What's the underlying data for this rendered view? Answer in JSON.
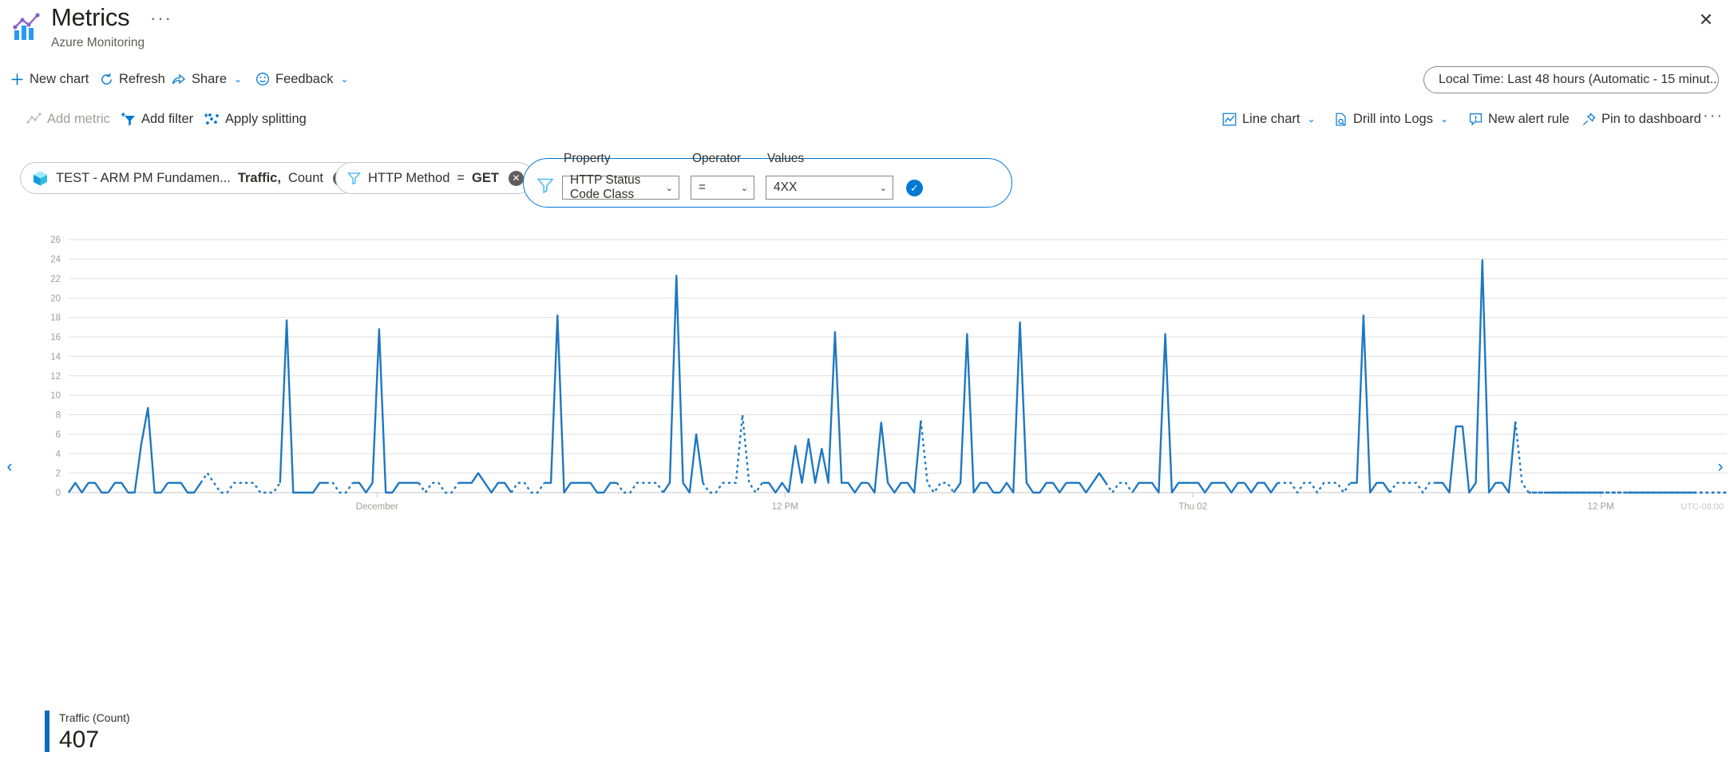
{
  "header": {
    "title": "Metrics",
    "subtitle": "Azure Monitoring",
    "more_label": "···",
    "close_label": "✕",
    "icon": "metrics-chart-icon"
  },
  "toolbar_primary": {
    "new_chart": "New chart",
    "refresh": "Refresh",
    "share": "Share",
    "feedback": "Feedback",
    "chevron": "⌄",
    "time_range": "Local Time: Last 48 hours (Automatic - 15 minut..."
  },
  "toolbar_secondary": {
    "add_metric": "Add metric",
    "add_metric_disabled": true,
    "add_filter": "Add filter",
    "apply_splitting": "Apply splitting",
    "line_chart": "Line chart",
    "drill_into_logs": "Drill into Logs",
    "new_alert_rule": "New alert rule",
    "pin_to_dashboard": "Pin to dashboard",
    "overflow": "···"
  },
  "chips": [
    {
      "icon": "resource-cube-icon",
      "resource": "TEST - ARM PM Fundamen...",
      "metric": "Traffic,",
      "aggregation": "Count",
      "remove": "✕"
    },
    {
      "icon": "filter-funnel-icon",
      "property": "HTTP Method",
      "operator": "=",
      "value": "GET",
      "remove": "✕"
    }
  ],
  "filter_editor": {
    "icon": "filter-funnel-icon",
    "property_label": "Property",
    "property_value": "HTTP Status Code Class",
    "operator_label": "Operator",
    "operator_value": "=",
    "values_label": "Values",
    "values_value": "4XX",
    "confirm": "✓",
    "caret": "⌄"
  },
  "navigation": {
    "prev": "‹",
    "next": "›"
  },
  "legend": {
    "series_name": "Traffic (Count)",
    "series_value": "407",
    "color": "#0f6cbd"
  },
  "colors": {
    "accent": "#0078d4",
    "line": "#1f78c1",
    "grid": "#e1dfdd",
    "axis_text": "#a19f9d"
  },
  "chart_data": {
    "type": "line",
    "title": "",
    "xlabel": "",
    "ylabel": "",
    "ylim": [
      0,
      27
    ],
    "yticks": [
      0,
      2,
      4,
      6,
      8,
      10,
      12,
      14,
      16,
      18,
      20,
      22,
      24,
      26
    ],
    "grid": true,
    "legend_position": "bottom-left",
    "timezone_note": "UTC-08:00",
    "xtick_labels": [
      "December",
      "12 PM",
      "Thu 02",
      "12 PM"
    ],
    "xtick_positions": [
      0.186,
      0.432,
      0.678,
      0.924
    ],
    "series": [
      {
        "name": "Traffic (Count)",
        "color": "#1f78c1",
        "total": 407,
        "values": [
          0,
          1,
          0,
          1,
          1,
          0,
          0,
          1,
          1,
          0,
          0,
          5,
          8.7,
          0,
          0,
          1,
          1,
          1,
          0,
          0,
          1,
          2,
          1,
          0,
          0,
          1,
          1,
          1,
          1,
          0,
          0,
          0,
          1,
          17.7,
          0,
          0,
          0,
          0,
          1,
          1,
          1,
          0,
          0,
          1,
          1,
          0,
          1,
          16.8,
          0,
          0,
          1,
          1,
          1,
          1,
          0,
          1,
          1,
          0,
          0,
          1,
          1,
          1,
          2,
          1,
          0,
          1,
          1,
          0,
          1,
          1,
          0,
          0,
          1,
          1,
          18.2,
          0,
          1,
          1,
          1,
          1,
          0,
          0,
          1,
          1,
          0,
          0,
          1,
          1,
          1,
          1,
          0,
          1,
          22.3,
          1,
          0,
          6,
          1,
          0,
          0,
          1,
          1,
          1,
          8,
          1,
          0,
          1,
          1,
          0,
          1,
          0,
          4.8,
          1,
          5.5,
          1,
          4.5,
          1,
          16.5,
          1,
          1,
          0,
          1,
          1,
          0,
          7.2,
          1,
          0,
          1,
          1,
          0,
          7.4,
          1,
          0,
          1,
          1,
          0,
          1,
          16.3,
          0,
          1,
          1,
          0,
          0,
          1,
          0,
          17.5,
          1,
          0,
          0,
          1,
          1,
          0,
          1,
          1,
          1,
          0,
          1,
          2,
          1,
          0,
          1,
          1,
          0,
          1,
          1,
          1,
          0,
          16.3,
          0,
          1,
          1,
          1,
          1,
          0,
          1,
          1,
          1,
          0,
          1,
          1,
          0,
          1,
          1,
          0,
          1,
          1,
          1,
          0,
          1,
          1,
          0,
          1,
          1,
          1,
          0,
          1,
          1,
          18.2,
          0,
          1,
          1,
          0,
          1,
          1,
          1,
          1,
          0,
          1,
          1,
          1,
          0,
          6.8,
          6.8,
          0,
          1,
          23.9,
          0,
          1,
          1,
          0,
          7.3,
          1,
          0,
          0,
          0,
          0,
          0,
          0,
          0,
          0,
          0,
          0,
          0,
          0,
          0,
          0,
          0,
          0,
          0,
          0,
          0,
          0,
          0,
          0,
          0,
          0,
          0,
          0,
          0,
          0,
          0,
          0,
          0
        ]
      }
    ],
    "peaks": [
      {
        "index": 12,
        "value": 8.7
      },
      {
        "index": 33,
        "value": 17.7
      },
      {
        "index": 47,
        "value": 16.8
      },
      {
        "index": 74,
        "value": 18.2
      },
      {
        "index": 91,
        "value": 22.3
      },
      {
        "index": 114,
        "value": 16.5
      },
      {
        "index": 135,
        "value": 16.3
      },
      {
        "index": 143,
        "value": 17.5
      },
      {
        "index": 170,
        "value": 16.3
      },
      {
        "index": 198,
        "value": 18.2
      },
      {
        "index": 215,
        "value": 23.9
      }
    ]
  }
}
